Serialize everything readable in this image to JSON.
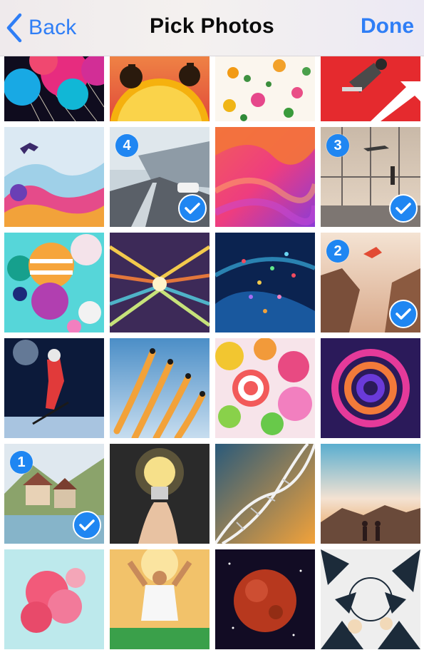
{
  "header": {
    "back_label": "Back",
    "title": "Pick Photos",
    "done_label": "Done"
  },
  "accent_color": "#2f7ef6",
  "selection_color": "#1f86f2",
  "photos": [
    {
      "name": "photo-balloons",
      "selected": false
    },
    {
      "name": "photo-alarm-clock-sunset",
      "selected": false
    },
    {
      "name": "photo-floral-pattern",
      "selected": false
    },
    {
      "name": "photo-businessman-rocket",
      "selected": false
    },
    {
      "name": "photo-splash-jumper",
      "selected": false
    },
    {
      "name": "photo-airport-road",
      "selected": true,
      "order": "4"
    },
    {
      "name": "photo-gradient-waves",
      "selected": false
    },
    {
      "name": "photo-airport-window",
      "selected": true,
      "order": "3"
    },
    {
      "name": "photo-3d-spheres",
      "selected": false
    },
    {
      "name": "photo-speed-tunnel",
      "selected": false
    },
    {
      "name": "photo-particles-abstract",
      "selected": false
    },
    {
      "name": "photo-canyon-jump",
      "selected": true,
      "order": "2"
    },
    {
      "name": "photo-hockey-player",
      "selected": false
    },
    {
      "name": "photo-air-show-jets",
      "selected": false
    },
    {
      "name": "photo-candies",
      "selected": false
    },
    {
      "name": "photo-paint-swirl",
      "selected": false
    },
    {
      "name": "photo-lakeside-village",
      "selected": true,
      "order": "1"
    },
    {
      "name": "photo-lightbulb-brain",
      "selected": false
    },
    {
      "name": "photo-dna-helix",
      "selected": false
    },
    {
      "name": "photo-mountain-sunset",
      "selected": false
    },
    {
      "name": "photo-ink-in-water",
      "selected": false
    },
    {
      "name": "photo-soccer-celebration",
      "selected": false
    },
    {
      "name": "photo-red-planet",
      "selected": false
    },
    {
      "name": "photo-into-the-wild-poster",
      "selected": false
    }
  ]
}
